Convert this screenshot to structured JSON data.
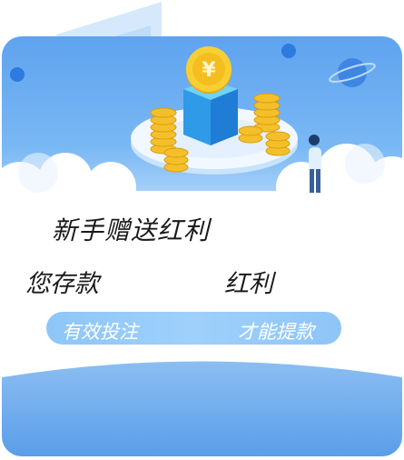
{
  "promo": {
    "title": "新手赠送红利",
    "deposit_label": "您存款",
    "bonus_label": "红利",
    "condition_left": "有效投注",
    "condition_right": "才能提款"
  },
  "colors": {
    "card_blue": "#6aaaf0",
    "pill_blue": "#97cbf9",
    "text_dark": "#1a1a1a",
    "text_white": "#ffffff",
    "coin_gold": "#f6c82a"
  },
  "icons": [
    "yen-coin-icon",
    "coin-stack-icon",
    "planet-icon",
    "person-figure-icon",
    "window-panel-icon"
  ]
}
